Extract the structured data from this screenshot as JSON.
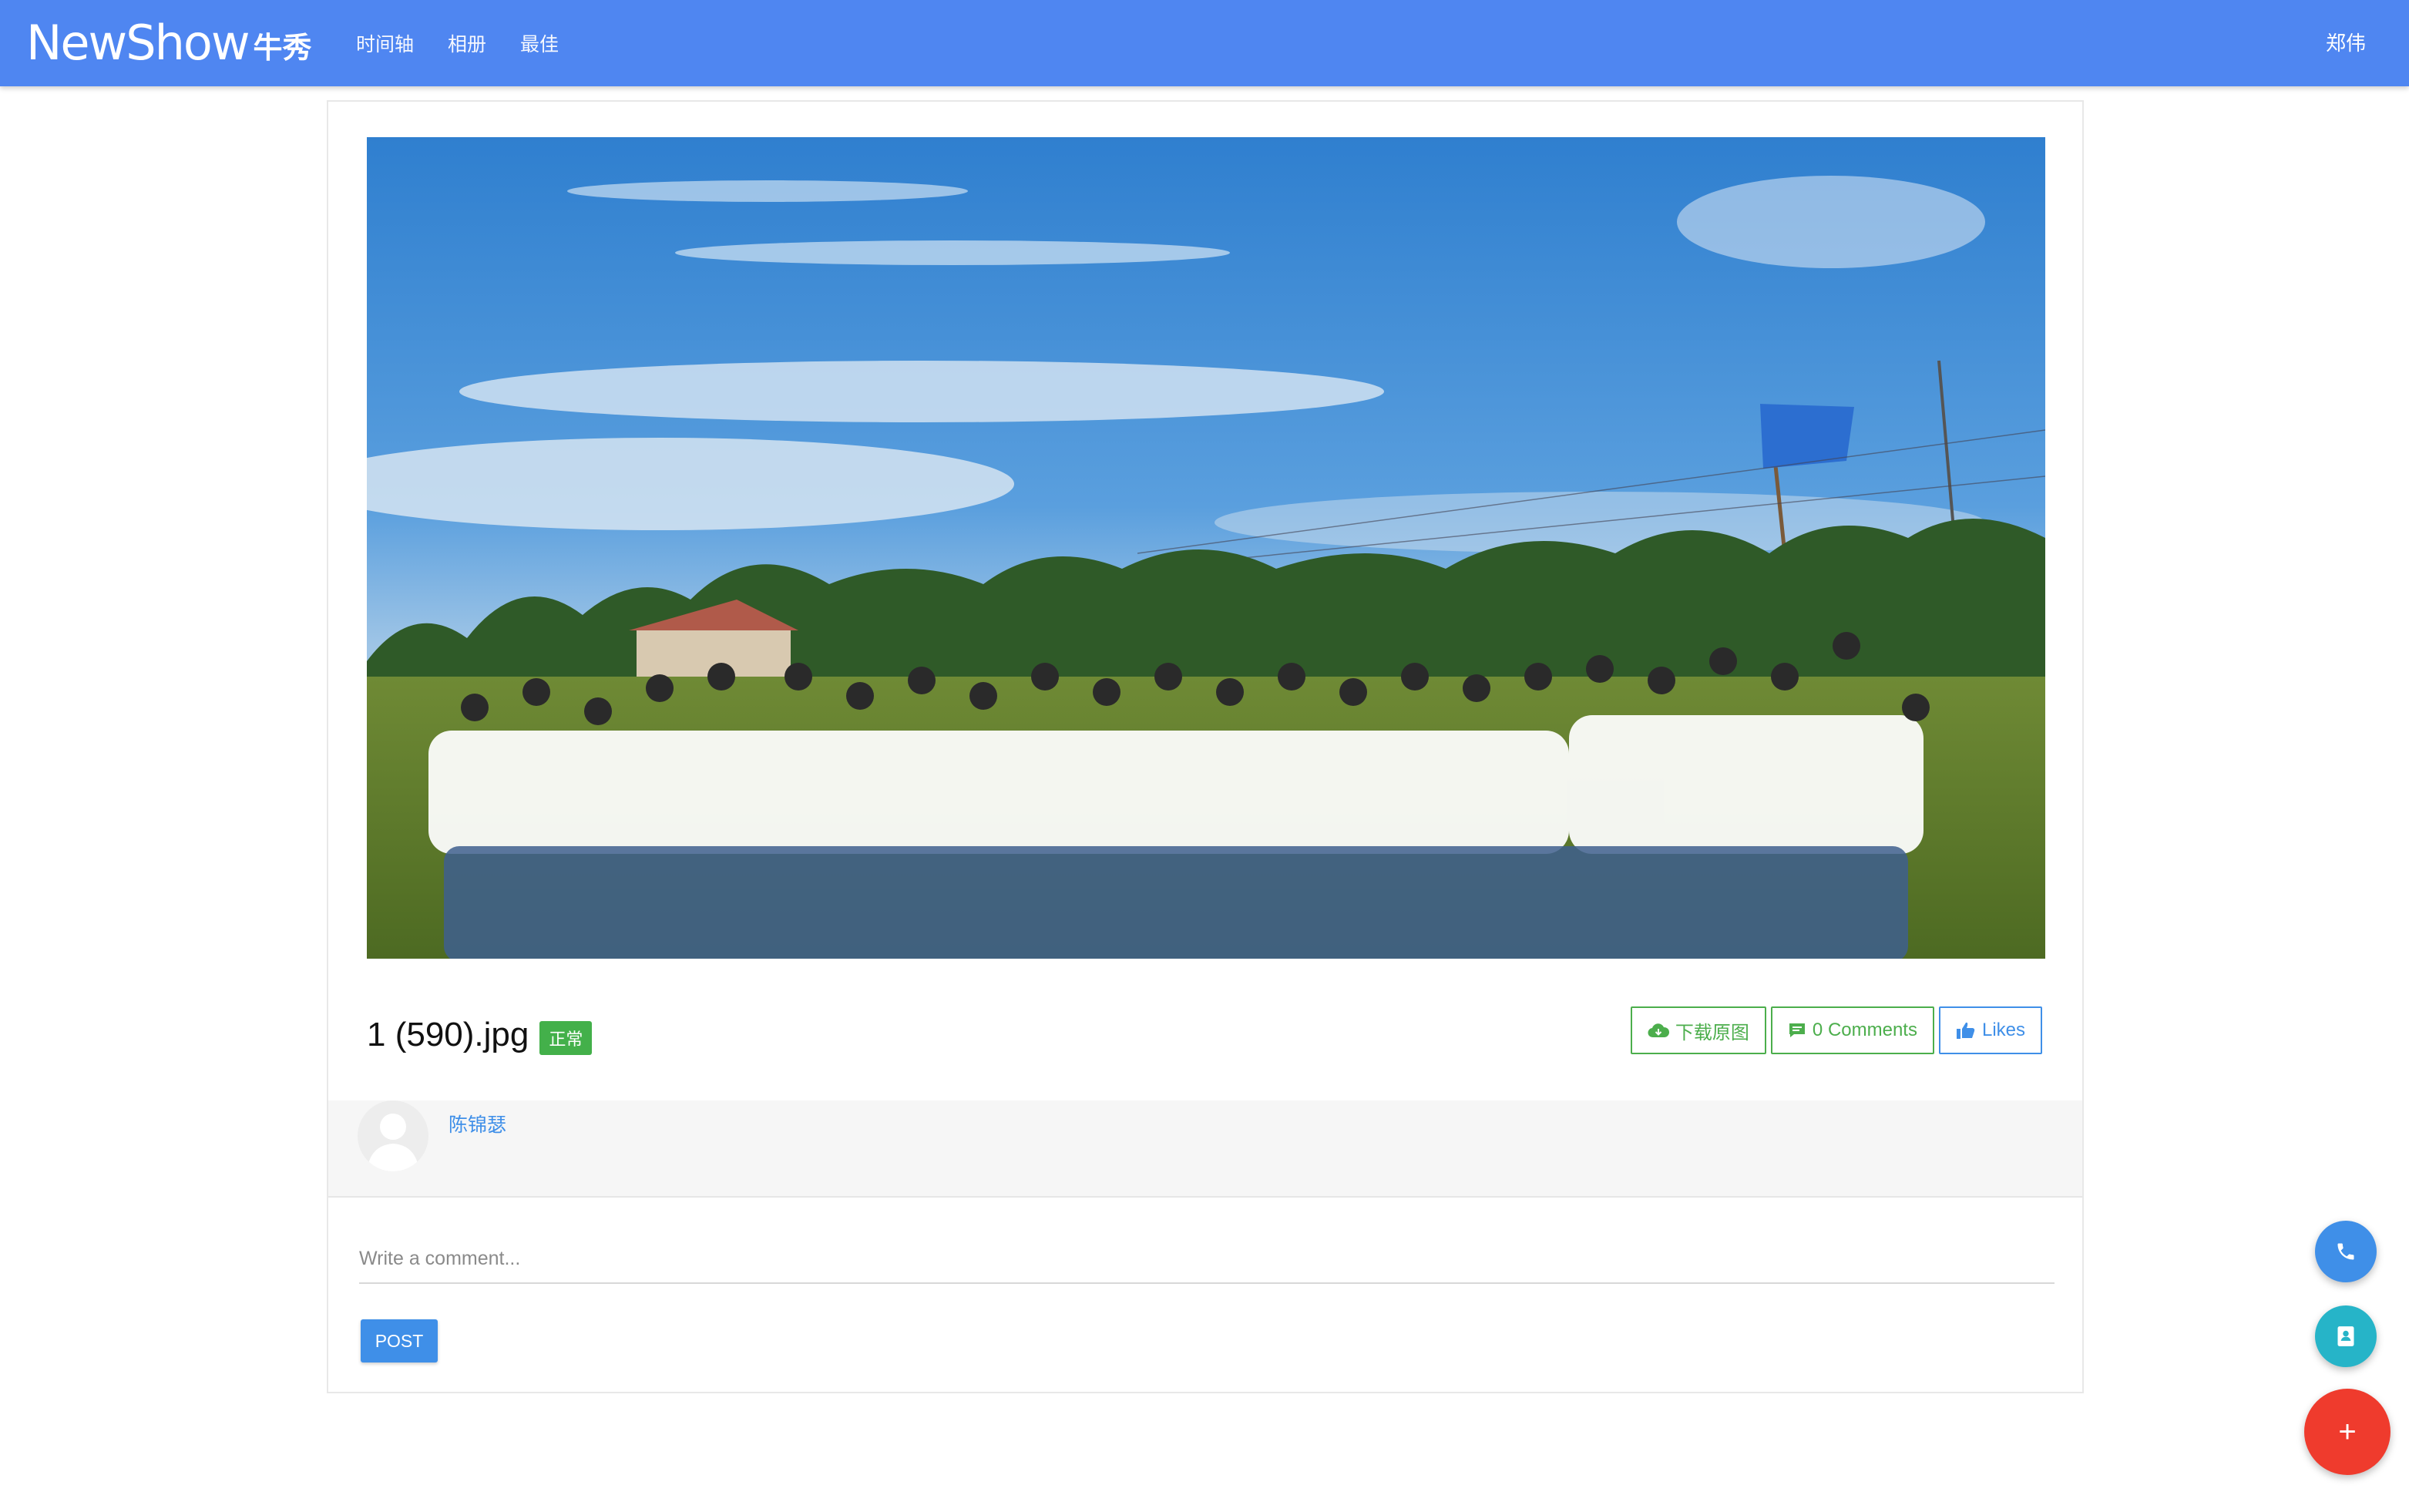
{
  "header": {
    "logo_en": "NewShow",
    "logo_cn": "牛秀",
    "nav": [
      "时间轴",
      "相册",
      "最佳"
    ],
    "user": "郑伟"
  },
  "photo": {
    "file_name": "1 (590).jpg",
    "status": "正常",
    "description_icon": "group-photo"
  },
  "actions": {
    "download": "下载原图",
    "comments": "0 Comments",
    "likes": "Likes"
  },
  "author": {
    "name": "陈锦瑟"
  },
  "comment": {
    "placeholder": "Write a comment...",
    "post_label": "POST"
  },
  "fabs": {
    "add_symbol": "+"
  },
  "colors": {
    "topbar": "#4f86f1",
    "accent_blue": "#3f8fe8",
    "accent_green": "#4cae4c",
    "fab_red": "#ef3b2d",
    "fab_teal": "#26b4c8"
  }
}
